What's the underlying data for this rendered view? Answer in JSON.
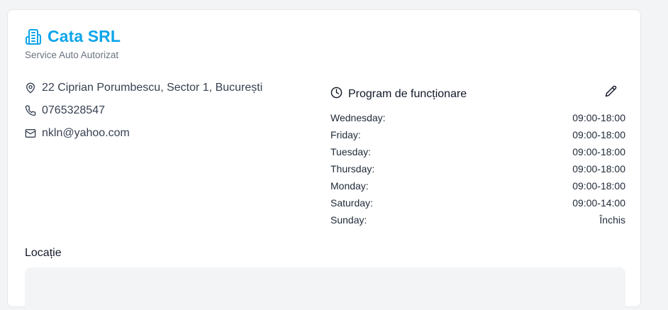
{
  "business": {
    "name": "Cata SRL",
    "subtitle": "Service Auto Autorizat",
    "icon": "building-icon",
    "accent_color": "#0ea5e9"
  },
  "contact": {
    "address": "22 Ciprian Porumbescu, Sector 1, București",
    "phone": "0765328547",
    "email": "nkln@yahoo.com"
  },
  "schedule": {
    "title": "Program de funcționare",
    "days": [
      {
        "day": "Wednesday:",
        "hours": "09:00-18:00"
      },
      {
        "day": "Friday:",
        "hours": "09:00-18:00"
      },
      {
        "day": "Tuesday:",
        "hours": "09:00-18:00"
      },
      {
        "day": "Thursday:",
        "hours": "09:00-18:00"
      },
      {
        "day": "Monday:",
        "hours": "09:00-18:00"
      },
      {
        "day": "Saturday:",
        "hours": "09:00-14:00"
      },
      {
        "day": "Sunday:",
        "hours": "Închis"
      }
    ]
  },
  "location": {
    "label": "Locație"
  }
}
